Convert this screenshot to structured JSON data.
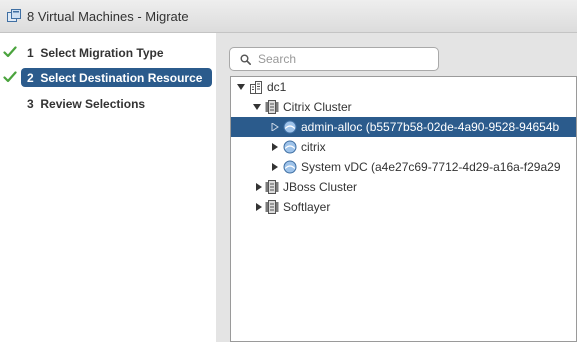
{
  "window": {
    "title": "8 Virtual Machines - Migrate",
    "icon": "vm-migrate-icon"
  },
  "steps": [
    {
      "number": "1",
      "label": "Select Migration Type",
      "completed": true,
      "active": false
    },
    {
      "number": "2",
      "label": "Select Destination Resource",
      "completed": true,
      "active": true
    },
    {
      "number": "3",
      "label": "Review Selections",
      "completed": false,
      "active": false
    }
  ],
  "search": {
    "placeholder": "Search",
    "value": ""
  },
  "tree": {
    "nodes": [
      {
        "label": "dc1",
        "icon": "datacenter-icon",
        "expanded": true
      },
      {
        "label": "Citrix Cluster",
        "icon": "cluster-icon",
        "expanded": true
      },
      {
        "label": "admin-alloc (b5577b58-02de-4a90-9528-94654b",
        "icon": "resource-pool-icon",
        "expanded": false,
        "selected": true
      },
      {
        "label": "citrix",
        "icon": "resource-pool-icon",
        "expanded": false
      },
      {
        "label": "System vDC (a4e27c69-7712-4d29-a16a-f29a29",
        "icon": "resource-pool-icon",
        "expanded": false
      },
      {
        "label": "JBoss Cluster",
        "icon": "cluster-icon",
        "expanded": false
      },
      {
        "label": "Softlayer",
        "icon": "cluster-icon",
        "expanded": false
      }
    ]
  },
  "colors": {
    "selection": "#2b5b8c",
    "check": "#4aa33d",
    "pane_background": "#e4e4e4"
  }
}
